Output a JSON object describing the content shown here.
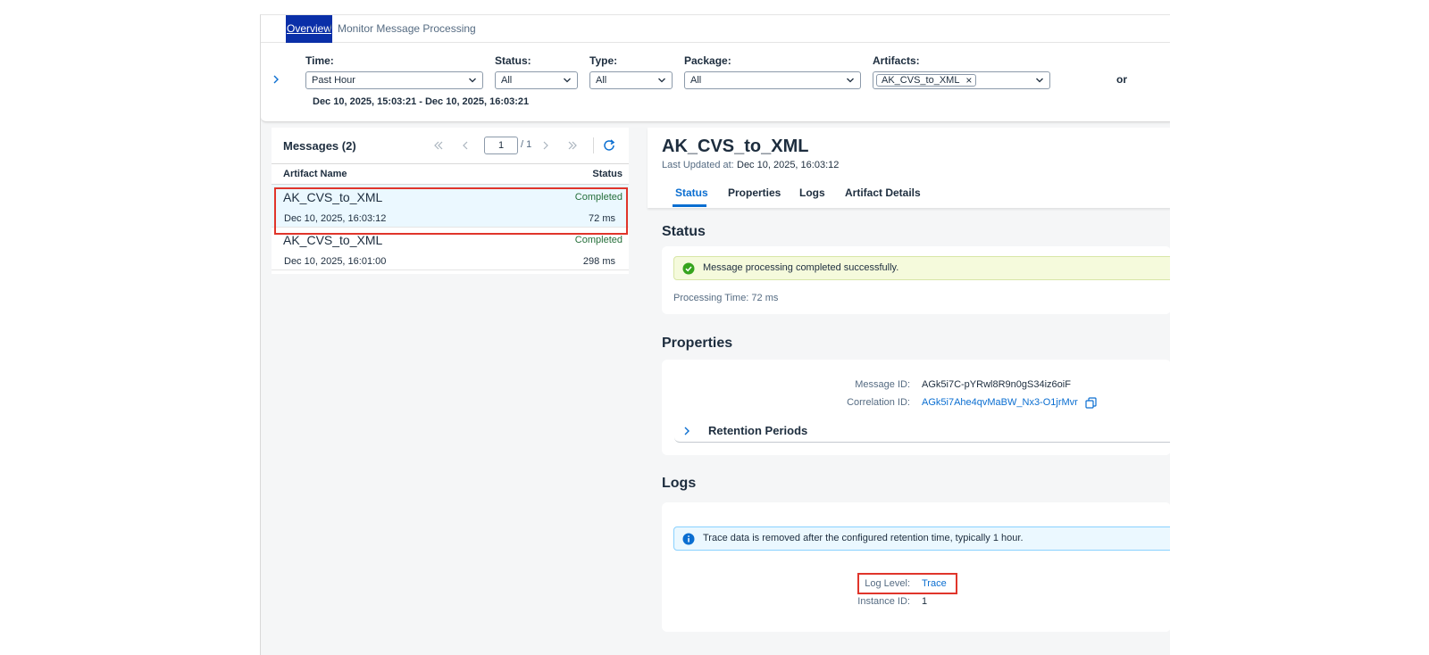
{
  "breadcrumb": {
    "root": "Overview",
    "separator": "/",
    "current": "Monitor Message Processing"
  },
  "filters": {
    "time": {
      "label": "Time:",
      "value": "Past Hour"
    },
    "status": {
      "label": "Status:",
      "value": "All"
    },
    "type": {
      "label": "Type:",
      "value": "All"
    },
    "package": {
      "label": "Package:",
      "value": "All"
    },
    "artifacts": {
      "label": "Artifacts:",
      "token": "AK_CVS_to_XML",
      "token_remove": "×"
    },
    "time_range": "Dec 10, 2025, 15:03:21 - Dec 10, 2025, 16:03:21",
    "or_label": "or"
  },
  "messages": {
    "title": "Messages (2)",
    "page": "1",
    "page_total": "/ 1",
    "columns": {
      "name": "Artifact Name",
      "status": "Status"
    },
    "rows": [
      {
        "name": "AK_CVS_to_XML",
        "status": "Completed",
        "date": "Dec 10, 2025, 16:03:12",
        "duration": "72 ms"
      },
      {
        "name": "AK_CVS_to_XML",
        "status": "Completed",
        "date": "Dec 10, 2025, 16:01:00",
        "duration": "298 ms"
      }
    ]
  },
  "detail": {
    "title": "AK_CVS_to_XML",
    "updated_label": "Last Updated at:",
    "updated_value": "Dec 10, 2025, 16:03:12",
    "tabs": [
      "Status",
      "Properties",
      "Logs",
      "Artifact Details"
    ],
    "status_section": {
      "title": "Status",
      "message": "Message processing completed successfully.",
      "processing_time": "Processing Time: 72 ms"
    },
    "properties_section": {
      "title": "Properties",
      "message_id_label": "Message ID:",
      "message_id": "AGk5i7C-pYRwl8R9n0gS34iz6oiF",
      "correlation_id_label": "Correlation ID:",
      "correlation_id": "AGk5i7Ahe4qvMaBW_Nx3-O1jrMvr",
      "retention_label": "Retention Periods"
    },
    "logs_section": {
      "title": "Logs",
      "info": "Trace data is removed after the configured retention time, typically 1 hour.",
      "log_level_label": "Log Level:",
      "log_level": "Trace",
      "instance_id_label": "Instance ID:",
      "instance_id": "1"
    }
  },
  "colors": {
    "accent": "#0a6ed1",
    "success": "#256f3a",
    "highlight": "#e0352b",
    "breadcrumb_focus": "#0a2fa8"
  },
  "icons": [
    "chevron-right-icon",
    "chevron-down-icon",
    "first-page-icon",
    "previous-page-icon",
    "next-page-icon",
    "last-page-icon",
    "refresh-icon",
    "success-icon",
    "info-icon",
    "copy-icon"
  ]
}
